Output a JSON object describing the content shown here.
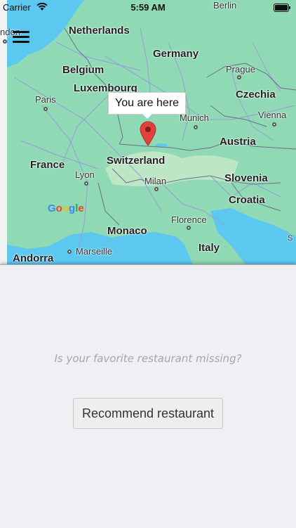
{
  "status_bar": {
    "carrier": "Carrier",
    "time": "5:59 AM"
  },
  "map": {
    "callout": "You are here",
    "countries": [
      "Netherlands",
      "Germany",
      "Belgium",
      "Luxembourg",
      "Czechia",
      "France",
      "Switzerland",
      "Austria",
      "Slovenia",
      "Croatia",
      "Monaco",
      "Italy",
      "Andorra"
    ],
    "cities": [
      "Berlin",
      "Prague",
      "Paris",
      "Munich",
      "Vienna",
      "Lyon",
      "Milan",
      "Florence",
      "Marseille",
      "ndon"
    ],
    "logo": [
      "G",
      "o",
      "o",
      "g",
      "l",
      "e"
    ],
    "corner_mark": "S",
    "colors": {
      "land": "#8fd9b5",
      "water": "#5cc8f0",
      "road": "#9a9ed8",
      "border": "#6c6f8a",
      "pin": "#e3413b"
    }
  },
  "panel": {
    "missing_text": "Is your favorite restaurant missing?",
    "recommend_label": "Recommend restaurant"
  },
  "icons": {
    "menu": "hamburger-menu-icon",
    "pin": "location-pin-icon",
    "wifi": "wifi-icon",
    "battery": "battery-icon"
  }
}
